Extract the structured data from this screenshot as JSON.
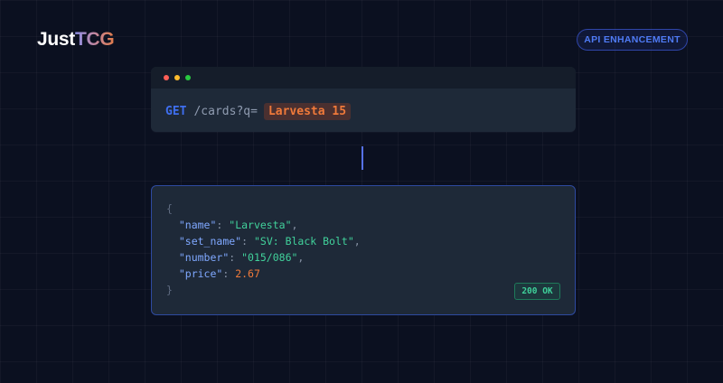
{
  "brand": {
    "part1": "Just",
    "part2": "TCG"
  },
  "badge": {
    "label": "API ENHANCEMENT"
  },
  "request": {
    "window_dots": [
      "#ff5f57",
      "#febc2e",
      "#28c840"
    ],
    "method": "GET",
    "path": "/cards?q=",
    "query": "Larvesta 15"
  },
  "response": {
    "open_brace": "{",
    "close_brace": "}",
    "fields": [
      {
        "key": "\"name\"",
        "value": "\"Larvesta\"",
        "sep": ": ",
        "trail": ","
      },
      {
        "key": "\"set_name\"",
        "value": "\"SV: Black Bolt\"",
        "sep": ": ",
        "trail": ","
      },
      {
        "key": "\"number\"",
        "value": "\"015/086\"",
        "sep": ": ",
        "trail": ","
      },
      {
        "key": "\"price\"",
        "value": "2.67",
        "sep": ": ",
        "trail": ""
      }
    ],
    "status": "200 OK"
  },
  "colors": {
    "accent_blue": "#3f6ff0",
    "accent_orange": "#f07a3a",
    "success_green": "#41d19b"
  }
}
